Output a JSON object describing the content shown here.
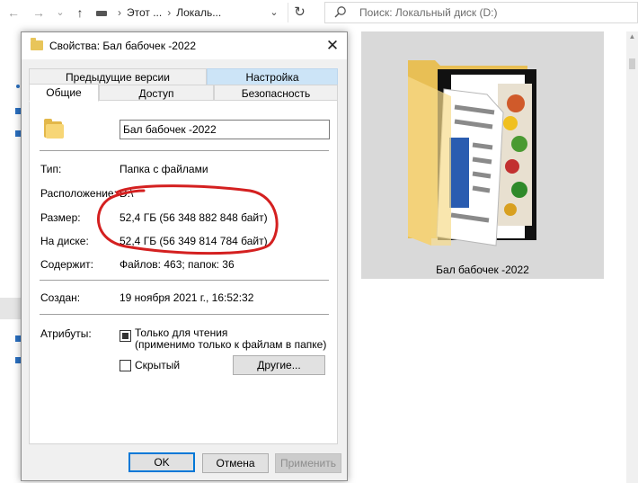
{
  "explorer": {
    "nav": {
      "back": "←",
      "forward": "→",
      "recent": "⌄",
      "up": "↑"
    },
    "address": {
      "seg1": "Этот ...",
      "seg2": "Локаль...",
      "chevron": "⌄",
      "refresh": "↻"
    },
    "search": {
      "icon": "search-icon",
      "placeholder": "Поиск: Локальный диск (D:)"
    },
    "preview": {
      "label": "Бал бабочек -2022"
    }
  },
  "dialog": {
    "title": "Свойства: Бал бабочек -2022",
    "close": "✕",
    "tabs_top": [
      "Предыдущие версии",
      "Настройка"
    ],
    "tabs_bottom": [
      "Общие",
      "Доступ",
      "Безопасность"
    ],
    "active_tab": "Общие",
    "folder_name": "Бал бабочек -2022",
    "type": {
      "label": "Тип:",
      "value": "Папка с файлами"
    },
    "location": {
      "label": "Расположение:",
      "value": "D:\\"
    },
    "size": {
      "label": "Размер:",
      "value": "52,4 ГБ (56 348 882 848 байт)"
    },
    "on_disk": {
      "label": "На диске:",
      "value": "52,4 ГБ (56 349 814 784 байт)"
    },
    "contains": {
      "label": "Содержит:",
      "value": "Файлов: 463; папок: 36"
    },
    "created": {
      "label": "Создан:",
      "value": "19 ноября 2021 г., 16:52:32"
    },
    "attributes": {
      "label": "Атрибуты:",
      "readonly_line1": "Только для чтения",
      "readonly_line2": "(применимо только к файлам в папке)",
      "readonly_checked": true,
      "hidden": "Скрытый",
      "hidden_checked": false,
      "other_button": "Другие..."
    },
    "buttons": {
      "ok": "OK",
      "cancel": "Отмена",
      "apply": "Применить"
    }
  },
  "colors": {
    "annotation": "#d42020",
    "accent": "#0078d7",
    "tab_highlight": "#cce4f7"
  }
}
